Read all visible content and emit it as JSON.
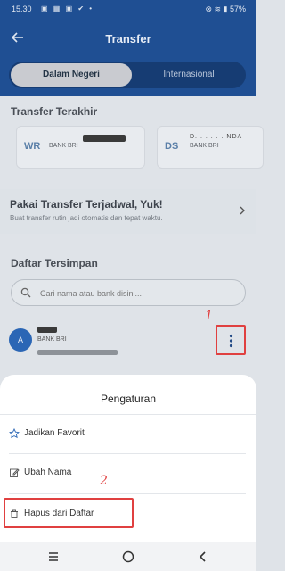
{
  "status": {
    "time": "15.30",
    "left_icons": "▣ ▦ ▣ ✔ •",
    "right_text": "⊗ ≋ ▮ 57%"
  },
  "header": {
    "title": "Transfer",
    "tabs": [
      "Dalam Negeri",
      "Internasional"
    ]
  },
  "recent": {
    "section_title": "Transfer Terakhir",
    "items": [
      {
        "initials": "WR",
        "bank": "BANK BRI"
      },
      {
        "initials": "DS",
        "bank": "BANK BRI",
        "name_fragment": "D. . . . . . NDA"
      }
    ]
  },
  "promo": {
    "title": "Pakai Transfer Terjadwal, Yuk!",
    "subtitle": "Buat transfer rutin jadi otomatis dan tepat waktu."
  },
  "saved": {
    "section_title": "Daftar Tersimpan",
    "search_placeholder": "Cari nama atau bank disini...",
    "item": {
      "initial": "A",
      "bank": "BANK BRI"
    }
  },
  "annotations": {
    "first": "1",
    "second": "2"
  },
  "sheet": {
    "title": "Pengaturan",
    "items": [
      {
        "label": "Jadikan Favorit",
        "icon": "star-icon"
      },
      {
        "label": "Ubah Nama",
        "icon": "edit-icon"
      },
      {
        "label": "Hapus dari Daftar",
        "icon": "trash-icon"
      }
    ]
  },
  "colors": {
    "accent": "#1f4f93",
    "annotation": "#e04040"
  }
}
